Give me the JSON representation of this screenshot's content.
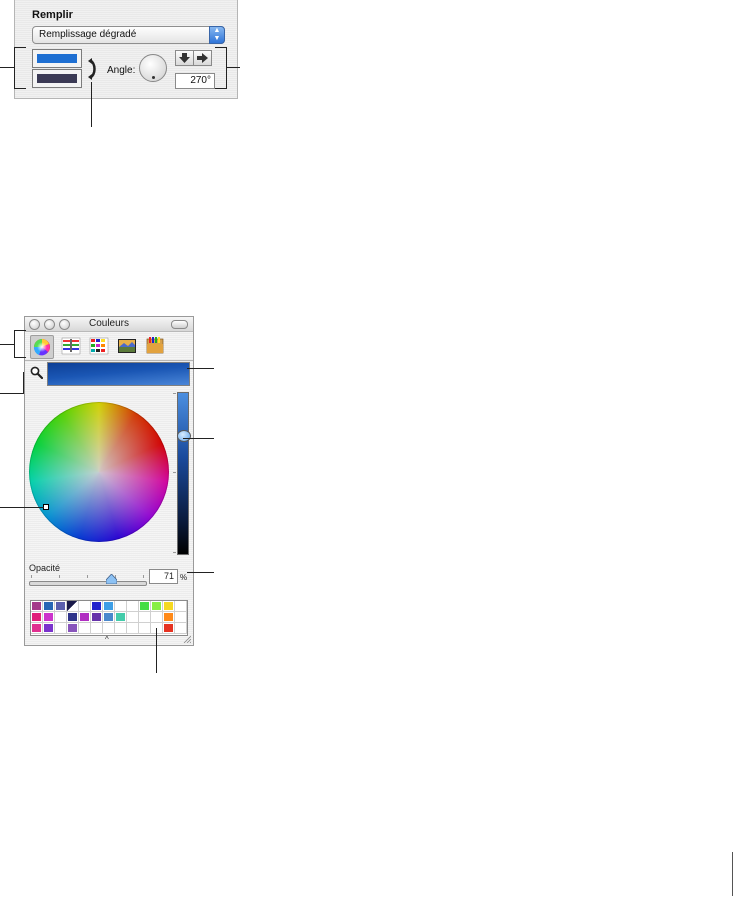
{
  "fill_inspector": {
    "title": "Remplir",
    "fill_type": "Remplissage dégradé",
    "color_top": "#1e6fd2",
    "color_bottom": "#3b3a55",
    "angle_label": "Angle:",
    "angle_value": "270°"
  },
  "colors_window": {
    "title": "Couleurs",
    "toolbar_icons": [
      "color-wheel-icon",
      "color-sliders-icon",
      "color-palettes-icon",
      "image-palettes-icon",
      "crayons-icon"
    ],
    "selected_tool": "color-wheel-icon",
    "current_color": "#1a56b4",
    "brightness_level": 0.27,
    "opacity_label": "Opacité",
    "opacity_value": "71",
    "opacity_unit": "%",
    "opacity_level": 0.71,
    "swatches": [
      [
        "#a43a8a",
        "#2767b5",
        "#5b5fae",
        "split",
        "#ffffff",
        "#2222cc",
        "#3d9ee6",
        "#ffffff",
        "#ffffff",
        "#44dd44",
        "#88ee44",
        "#f5d820",
        "#ffffff",
        "#f5e040"
      ],
      [
        "#e0207a",
        "#cc33cc",
        "#ffffff",
        "#30348a",
        "#b02ec2",
        "#6633aa",
        "#4a88cc",
        "#44ccaa",
        "#ffffff",
        "#ffffff",
        "#ffffff",
        "#ff8a1a",
        "#ffffff",
        "#ffffff"
      ],
      [
        "#e03090",
        "#7a33cc",
        "#ffffff",
        "#8855bb",
        "#ffffff",
        "#ffffff",
        "#ffffff",
        "#ffffff",
        "#ffffff",
        "#ffffff",
        "#ffffff",
        "#e63322",
        "#ffffff",
        "#ffffff"
      ]
    ]
  }
}
